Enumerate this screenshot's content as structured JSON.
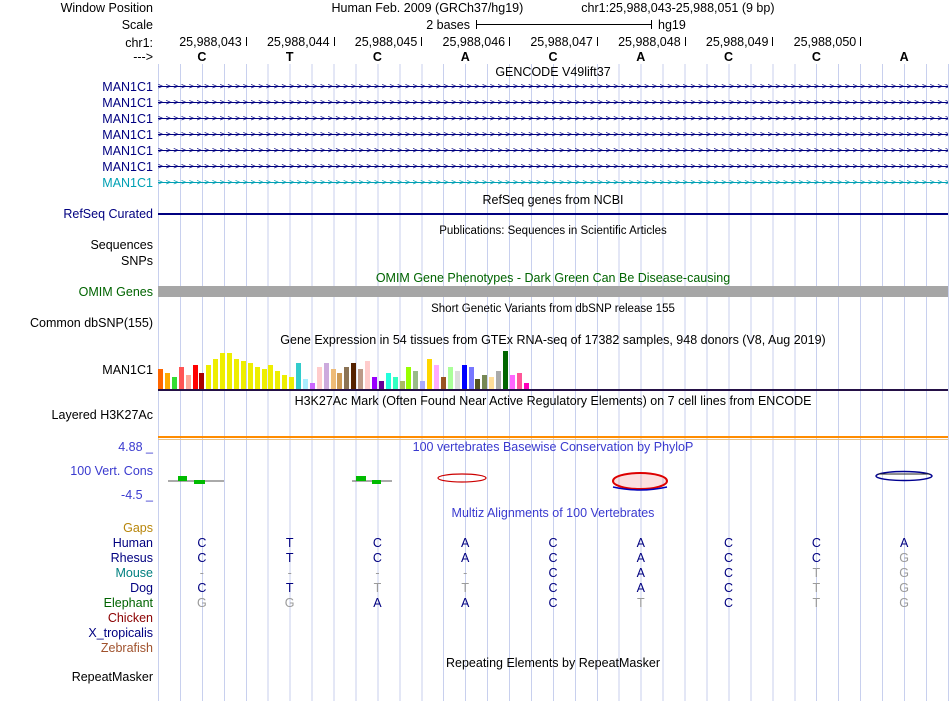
{
  "header": {
    "assembly_line": "Human Feb. 2009 (GRCh37/hg19)",
    "position_line": "chr1:25,988,043-25,988,051 (9 bp)",
    "labels": {
      "window_position": "Window Position",
      "scale": "Scale",
      "chrom": "chr1:",
      "strand": "--->"
    },
    "scale_value": "2 bases",
    "scale_assembly": "hg19",
    "ruler_numbers": [
      "25,988,043",
      "25,988,044",
      "25,988,045",
      "25,988,046",
      "25,988,047",
      "25,988,048",
      "25,988,049",
      "25,988,050"
    ],
    "bases": [
      "C",
      "T",
      "C",
      "A",
      "C",
      "A",
      "C",
      "C",
      "A"
    ]
  },
  "tracks": {
    "gencode": {
      "title": "GENCODE V49lift37",
      "genes": [
        {
          "label": "MAN1C1",
          "color": "#000080"
        },
        {
          "label": "MAN1C1",
          "color": "#000080"
        },
        {
          "label": "MAN1C1",
          "color": "#000080"
        },
        {
          "label": "MAN1C1",
          "color": "#000080"
        },
        {
          "label": "MAN1C1",
          "color": "#000080"
        },
        {
          "label": "MAN1C1",
          "color": "#000080"
        },
        {
          "label": "MAN1C1",
          "color": "#00a0b4"
        }
      ]
    },
    "refseq": {
      "title": "RefSeq genes from NCBI",
      "label": "RefSeq Curated"
    },
    "publications": {
      "title": "Publications: Sequences in Scientific Articles",
      "label_sequences": "Sequences",
      "label_snps": "SNPs"
    },
    "omim": {
      "title": "OMIM Gene Phenotypes - Dark Green Can Be Disease-causing",
      "label": "OMIM Genes",
      "bar_color": "#a6a6a6"
    },
    "dbsnp": {
      "title": "Short Genetic Variants from dbSNP release 155",
      "label": "Common dbSNP(155)"
    },
    "gtex": {
      "title": "Gene Expression in 54 tissues from GTEx RNA-seq of 17382 samples, 948 donors (V8, Aug 2019)",
      "label": "MAN1C1"
    },
    "h3k27ac": {
      "title": "H3K27Ac Mark (Often Found Near Active Regulatory Elements) on 7 cell lines from ENCODE",
      "label": "Layered H3K27Ac",
      "color": "#ff8c00"
    },
    "conservation": {
      "title": "100 vertebrates Basewise Conservation by PhyloP",
      "label": "100 Vert. Cons",
      "max_label": "4.88 _",
      "min_label": "-4.5 _"
    },
    "multiz": {
      "title": "Multiz Alignments of 100 Vertebrates",
      "rows": [
        {
          "name": "Gaps",
          "color": "#b8860b",
          "bases": [
            "",
            "",
            "",
            "",
            "",
            "",
            "",
            "",
            ""
          ],
          "dim": [
            0,
            0,
            0,
            0,
            0,
            0,
            0,
            0,
            0
          ]
        },
        {
          "name": "Human",
          "color": "#000080",
          "bases": [
            "C",
            "T",
            "C",
            "A",
            "C",
            "A",
            "C",
            "C",
            "A"
          ],
          "dim": [
            0,
            0,
            0,
            0,
            0,
            0,
            0,
            0,
            0
          ]
        },
        {
          "name": "Rhesus",
          "color": "#000080",
          "bases": [
            "C",
            "T",
            "C",
            "A",
            "C",
            "A",
            "C",
            "C",
            "G"
          ],
          "dim": [
            0,
            0,
            0,
            0,
            0,
            0,
            0,
            0,
            1
          ]
        },
        {
          "name": "Mouse",
          "color": "#008080",
          "bases": [
            "-",
            "-",
            "-",
            "-",
            "C",
            "A",
            "C",
            "T",
            "G"
          ],
          "dim": [
            1,
            1,
            1,
            1,
            0,
            0,
            0,
            1,
            1
          ]
        },
        {
          "name": "Dog",
          "color": "#000080",
          "bases": [
            "C",
            "T",
            "T",
            "T",
            "C",
            "A",
            "C",
            "T",
            "G"
          ],
          "dim": [
            0,
            0,
            1,
            1,
            0,
            0,
            0,
            1,
            1
          ]
        },
        {
          "name": "Elephant",
          "color": "#006400",
          "bases": [
            "G",
            "G",
            "A",
            "A",
            "C",
            "T",
            "C",
            "T",
            "G"
          ],
          "dim": [
            1,
            1,
            0,
            0,
            0,
            1,
            0,
            1,
            1
          ]
        },
        {
          "name": "Chicken",
          "color": "#8b0000",
          "bases": [
            "",
            "",
            "",
            "",
            "",
            "",
            "",
            "",
            ""
          ],
          "dim": [
            0,
            0,
            0,
            0,
            0,
            0,
            0,
            0,
            0
          ]
        },
        {
          "name": "X_tropicalis",
          "color": "#000080",
          "bases": [
            "",
            "",
            "",
            "",
            "",
            "",
            "",
            "",
            ""
          ],
          "dim": [
            0,
            0,
            0,
            0,
            0,
            0,
            0,
            0,
            0
          ]
        },
        {
          "name": "Zebrafish",
          "color": "#a0522d",
          "bases": [
            "",
            "",
            "",
            "",
            "",
            "",
            "",
            "",
            ""
          ],
          "dim": [
            0,
            0,
            0,
            0,
            0,
            0,
            0,
            0,
            0
          ]
        }
      ]
    },
    "repeatmasker": {
      "title": "Repeating Elements by RepeatMasker",
      "label": "RepeatMasker"
    }
  },
  "chart_data": {
    "type": "bar",
    "title": "Gene Expression in 54 tissues from GTEx RNA-seq of 17382 samples, 948 donors (V8, Aug 2019)",
    "gene": "MAN1C1",
    "n_bars": 54,
    "values": [
      20,
      16,
      12,
      22,
      14,
      24,
      16,
      24,
      30,
      36,
      36,
      30,
      28,
      26,
      22,
      20,
      24,
      18,
      14,
      12,
      26,
      10,
      6,
      22,
      26,
      20,
      16,
      22,
      26,
      20,
      28,
      12,
      8,
      16,
      12,
      8,
      22,
      18,
      8,
      30,
      24,
      12,
      22,
      18,
      24,
      22,
      10,
      14,
      12,
      18,
      38,
      14,
      16,
      6
    ],
    "colors": [
      "#FF6600",
      "#FFAA00",
      "#33DD33",
      "#FF5555",
      "#FFAA99",
      "#FF0000",
      "#AA0000",
      "#EEEE00",
      "#EEEE00",
      "#EEEE00",
      "#EEEE00",
      "#EEEE00",
      "#EEEE00",
      "#EEEE00",
      "#EEEE00",
      "#EEEE00",
      "#EEEE00",
      "#EEEE00",
      "#EEEE00",
      "#EEEE00",
      "#33CCCC",
      "#AAEEFF",
      "#CC66FF",
      "#FFCCCC",
      "#CCAADD",
      "#EEBB77",
      "#CC9955",
      "#8B7355",
      "#552200",
      "#BB9988",
      "#FFCCCC",
      "#9900FF",
      "#660099",
      "#22FFDD",
      "#33FFC2",
      "#AABB66",
      "#99FF00",
      "#99BB88",
      "#AAAAFF",
      "#FFD700",
      "#FFAAFF",
      "#995522",
      "#AAFF99",
      "#DDDDDD",
      "#0000FF",
      "#7777FF",
      "#555522",
      "#778855",
      "#FFDD99",
      "#AAAAAA",
      "#006600",
      "#FF66FF",
      "#FF5599",
      "#FF00BB"
    ]
  }
}
